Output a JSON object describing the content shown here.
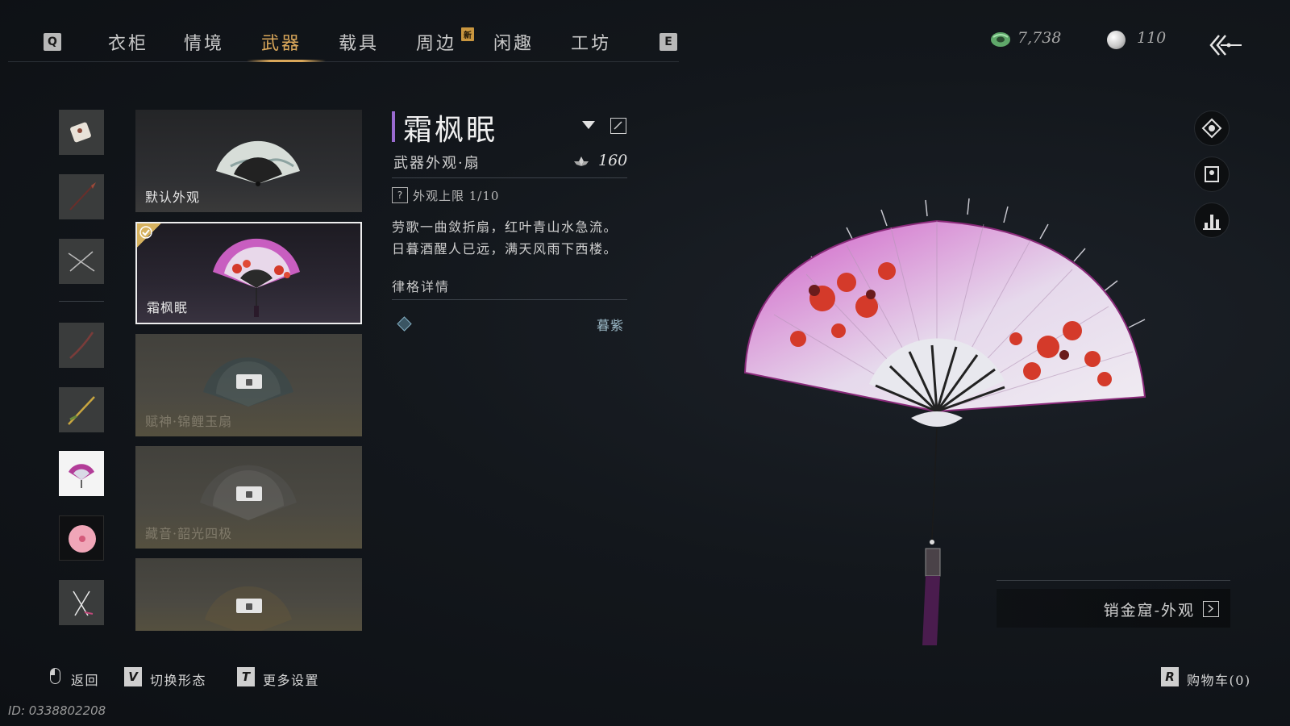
{
  "nav": {
    "left_key": "Q",
    "right_key": "E",
    "tabs": [
      {
        "label": "衣柜"
      },
      {
        "label": "情境"
      },
      {
        "label": "武器"
      },
      {
        "label": "载具"
      },
      {
        "label": "周边",
        "badge": "新"
      },
      {
        "label": "闲趣"
      },
      {
        "label": "工坊"
      }
    ],
    "active_tab": "武器"
  },
  "currency": {
    "jade": "7,738",
    "pearl": "110"
  },
  "categories": [
    {
      "icon": "weapon-charm-icon"
    },
    {
      "icon": "spear-icon"
    },
    {
      "icon": "dual-blades-icon"
    },
    {
      "icon": "staff-icon"
    },
    {
      "icon": "golden-spear-icon"
    },
    {
      "icon": "fan-icon",
      "selected": true
    },
    {
      "icon": "umbrella-icon"
    },
    {
      "icon": "crossed-swords-icon"
    }
  ],
  "variants": [
    {
      "name": "默认外观",
      "state": "default"
    },
    {
      "name": "霜枫眠",
      "state": "equipped"
    },
    {
      "name": "赋神·锦鲤玉扇",
      "state": "locked"
    },
    {
      "name": "藏音·韶光四极",
      "state": "locked"
    },
    {
      "name": "",
      "state": "locked"
    }
  ],
  "detail": {
    "title": "霜枫眠",
    "subtitle": "武器外观·扇",
    "points": "160",
    "limit_q": "?",
    "limit": "外观上限 1/10",
    "description_lines": [
      "劳歌一曲敛折扇，红叶青山水急流。",
      "日暮酒醒人已远，满天风雨下西楼。"
    ],
    "section_title": "律格详情",
    "attribute_value": "暮紫"
  },
  "shop": {
    "label": "销金窟-外观"
  },
  "hints": {
    "back_label": "返回",
    "switch_key": "V",
    "switch_label": "切换形态",
    "settings_key": "T",
    "settings_label": "更多设置",
    "cart_key": "R",
    "cart_label": "购物车(0)"
  },
  "uid": "ID: 0338802208",
  "colors": {
    "accent_gold": "#d9a75a",
    "title_accent_purple": "#9a6bd0",
    "fan_pink": "#c84fbf",
    "maple_red": "#d43a2a"
  }
}
